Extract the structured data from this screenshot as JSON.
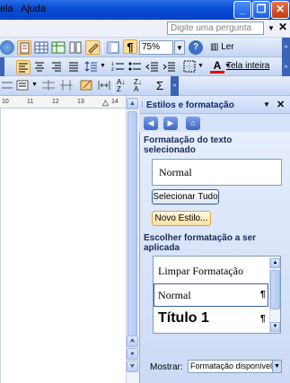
{
  "menu": {
    "items": [
      "ela",
      "Ajuda"
    ]
  },
  "ask": {
    "placeholder": "Digite uma pergunta"
  },
  "toolbar": {
    "zoom": "75%",
    "read_label": "Ler",
    "fullscreen_label": "Tela inteira",
    "paragraph_mark": "¶"
  },
  "ruler": {
    "ticks": [
      "10",
      "11",
      "12",
      "13",
      "14"
    ]
  },
  "pane": {
    "title": "Estilos e formatação",
    "section1_title": "Formatação do texto selecionado",
    "current_style": "Normal",
    "select_all_label": "Selecionar Tudo",
    "new_style_label": "Novo Estilo...",
    "section2_title": "Escolher formatação a ser aplicada",
    "styles": [
      {
        "label": "Limpar Formatação",
        "mark": ""
      },
      {
        "label": "Normal",
        "mark": "¶"
      },
      {
        "label": "Título 1",
        "mark": "¶"
      }
    ],
    "show_label": "Mostrar:",
    "show_value": "Formatação disponível"
  },
  "colors": {
    "title_bar": "#0a4fd6",
    "pane_bg": "#ccdaf5",
    "highlight": "#fde0a0"
  }
}
